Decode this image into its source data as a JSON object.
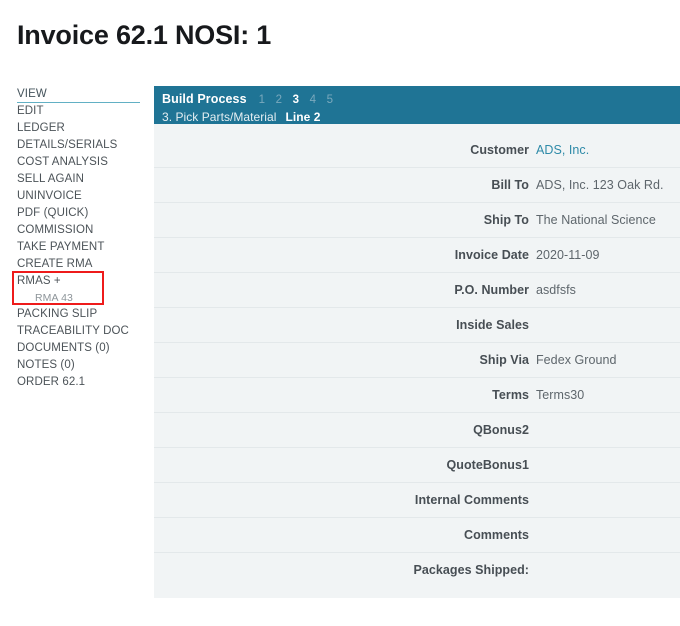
{
  "page": {
    "title": "Invoice 62.1 NOSI: 1"
  },
  "sidebar": {
    "items": [
      {
        "label": "VIEW",
        "active": true
      },
      {
        "label": "EDIT",
        "active": false
      },
      {
        "label": "LEDGER",
        "active": false
      },
      {
        "label": "DETAILS/SERIALS",
        "active": false
      },
      {
        "label": "COST ANALYSIS",
        "active": false
      },
      {
        "label": "SELL AGAIN",
        "active": false
      },
      {
        "label": "UNINVOICE",
        "active": false
      },
      {
        "label": "PDF (QUICK)",
        "active": false
      },
      {
        "label": "COMMISSION",
        "active": false
      },
      {
        "label": "TAKE PAYMENT",
        "active": false
      },
      {
        "label": "CREATE RMA",
        "active": false
      }
    ],
    "rmas": {
      "label": "RMAS +",
      "sub_label": "RMA 43",
      "highlight_color": "#ee1b1b"
    },
    "items_after": [
      {
        "label": "PACKING SLIP"
      },
      {
        "label": "TRACEABILITY DOC"
      },
      {
        "label": "DOCUMENTS (0)"
      },
      {
        "label": "NOTES (0)"
      },
      {
        "label": "ORDER 62.1"
      }
    ]
  },
  "panel": {
    "header": {
      "title": "Build Process",
      "steps": [
        "1",
        "2",
        "3",
        "4",
        "5"
      ],
      "current_step": "3",
      "subtitle": "3. Pick Parts/Material",
      "line": "Line 2",
      "background": "#1f7495"
    },
    "rows": [
      {
        "label": "Customer",
        "value": "ADS, Inc.",
        "is_link": true
      },
      {
        "label": "Bill To",
        "value": "ADS, Inc. 123 Oak Rd.",
        "is_link": false
      },
      {
        "label": "Ship To",
        "value": "The National Science",
        "is_link": false
      },
      {
        "label": "Invoice Date",
        "value": "2020-11-09",
        "is_link": false
      },
      {
        "label": "P.O. Number",
        "value": "asdfsfs",
        "is_link": false
      },
      {
        "label": "Inside Sales",
        "value": "",
        "is_link": false
      },
      {
        "label": "Ship Via",
        "value": "Fedex Ground",
        "is_link": false
      },
      {
        "label": "Terms",
        "value": "Terms30",
        "is_link": false
      },
      {
        "label": "QBonus2",
        "value": "",
        "is_link": false
      },
      {
        "label": "QuoteBonus1",
        "value": "",
        "is_link": false
      },
      {
        "label": "Internal Comments",
        "value": "",
        "is_link": false
      },
      {
        "label": "Comments",
        "value": "",
        "is_link": false
      },
      {
        "label": "Packages Shipped:",
        "value": "",
        "is_link": false
      }
    ]
  }
}
